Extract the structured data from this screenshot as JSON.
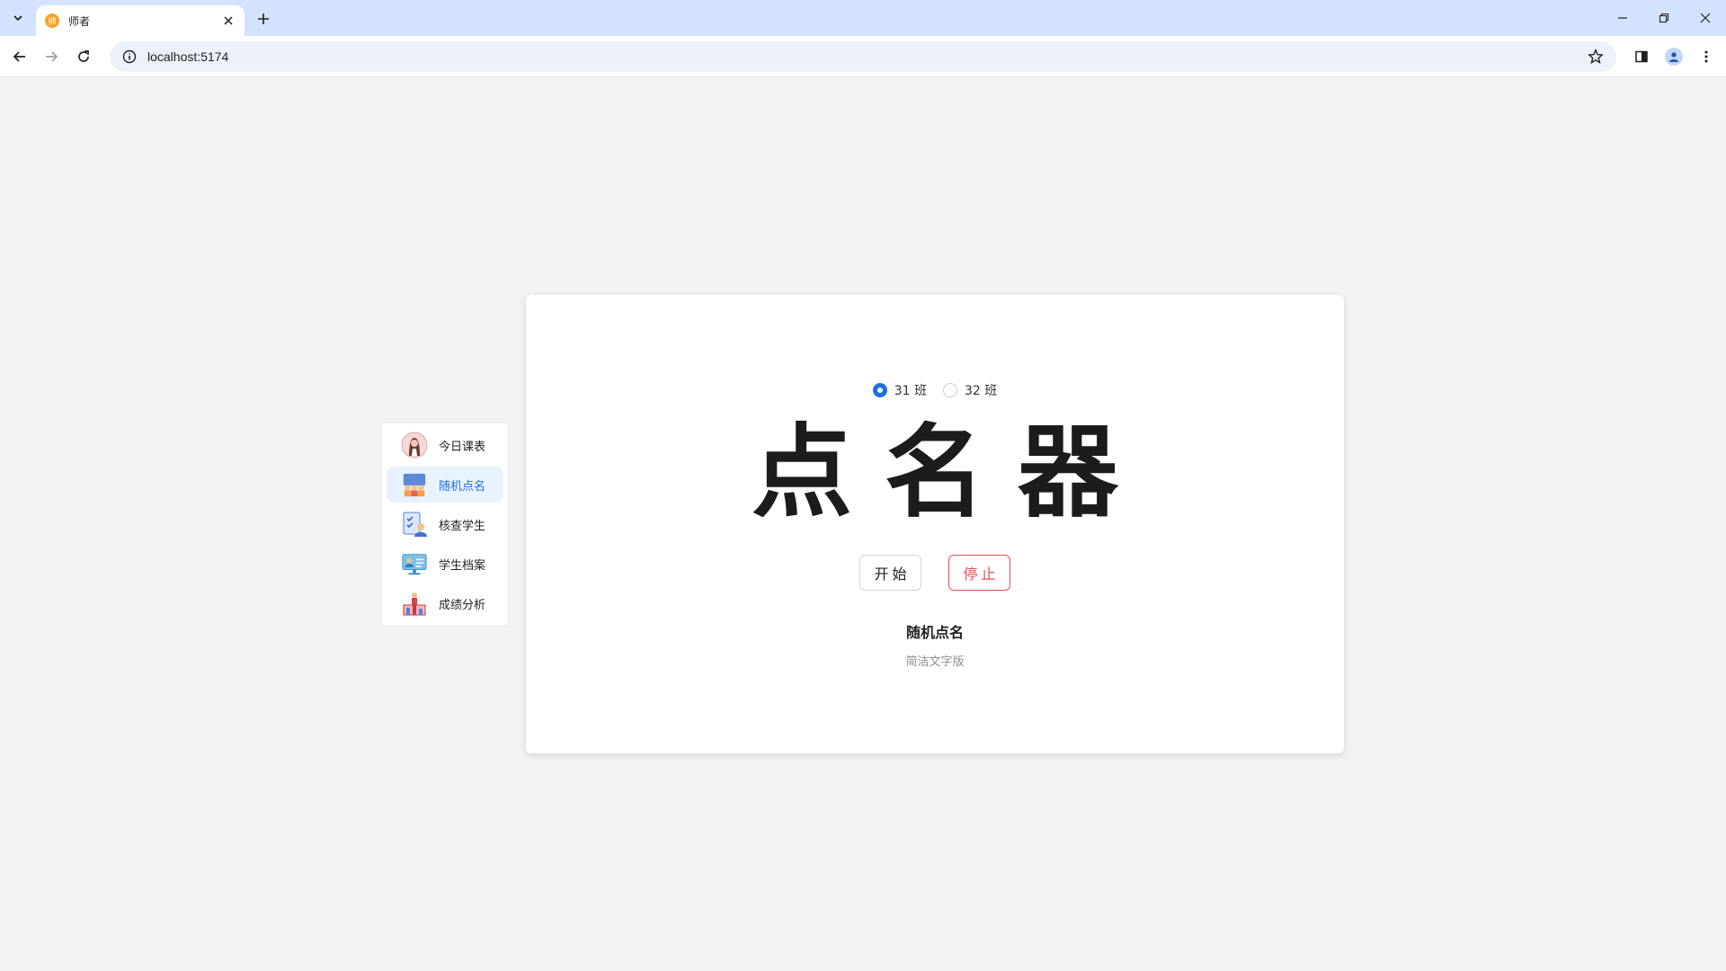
{
  "browser": {
    "tab_title": "师者",
    "favicon_text": "师",
    "url": "localhost:5174"
  },
  "sidebar": {
    "items": [
      {
        "label": "今日课表",
        "icon": "teacher-avatar-icon",
        "active": false
      },
      {
        "label": "随机点名",
        "icon": "class-group-icon",
        "active": true
      },
      {
        "label": "核查学生",
        "icon": "check-student-icon",
        "active": false
      },
      {
        "label": "学生档案",
        "icon": "student-profile-icon",
        "active": false
      },
      {
        "label": "成绩分析",
        "icon": "score-analysis-icon",
        "active": false
      }
    ]
  },
  "main": {
    "classes": [
      {
        "label": "31 班",
        "checked": true
      },
      {
        "label": "32 班",
        "checked": false
      }
    ],
    "headline": "点名器",
    "start_label": "开始",
    "stop_label": "停止",
    "section_title": "随机点名",
    "section_desc": "简洁文字版"
  },
  "colors": {
    "accent": "#1f6fe0",
    "stop": "#e65050",
    "page_bg": "#f1f2f4",
    "tabbar_bg": "#d3e3fd"
  }
}
